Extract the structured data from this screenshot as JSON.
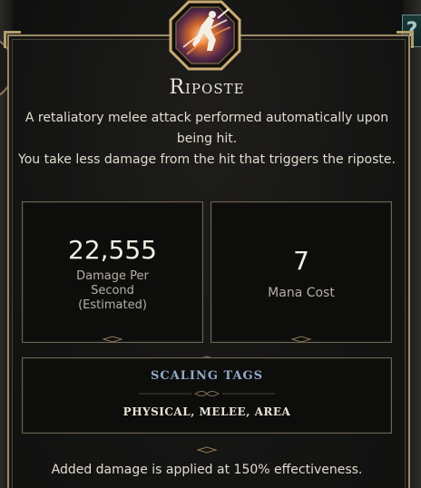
{
  "skill": {
    "name": "Riposte",
    "icon": "riposte-sword-figure-icon",
    "description_lines": [
      "A retaliatory melee attack performed automatically upon being hit.",
      "You take less damage from the hit that triggers the riposte."
    ]
  },
  "stats": {
    "damage": {
      "value": "22,555",
      "label_line1": "Damage Per",
      "label_line2": "Second",
      "label_line3": "(Estimated)"
    },
    "mana": {
      "value": "7",
      "label": "Mana Cost"
    }
  },
  "scaling": {
    "title": "SCALING TAGS",
    "tags": [
      "PHYSICAL",
      "MELEE",
      "AREA"
    ]
  },
  "footer": {
    "note": "Added damage is applied at 150% effectiveness."
  },
  "corner_badge": {
    "label": "?"
  },
  "colors": {
    "frame_gold": "#9a8a66",
    "text_main": "#e2dccd",
    "tags_title": "#93a9c8",
    "badge_teal": "#1b3a3a"
  }
}
